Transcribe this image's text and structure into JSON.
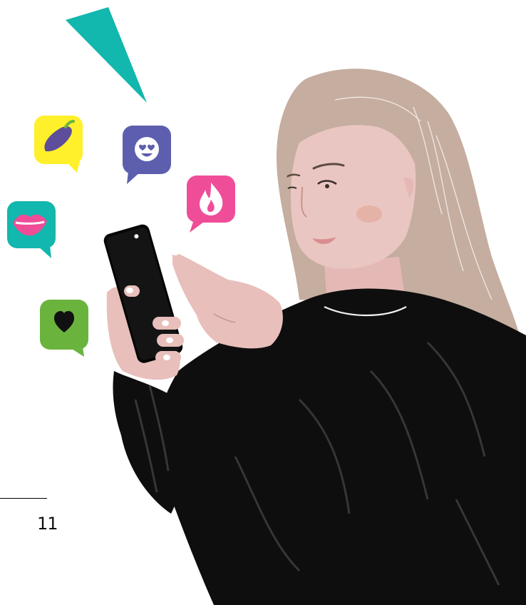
{
  "page": {
    "number": "11"
  },
  "palette": {
    "teal": "#12b7ad",
    "yellow": "#fff02b",
    "purple": "#5d5fae",
    "pink": "#ef4d98",
    "green": "#6ab43e",
    "hair": "#c5ad9f",
    "skin": "#eac6c2",
    "sweater": "#0e0e0e"
  },
  "icons": [
    "eggplant-icon",
    "heart-eyes-icon",
    "fire-icon",
    "lips-icon",
    "heart-icon"
  ]
}
